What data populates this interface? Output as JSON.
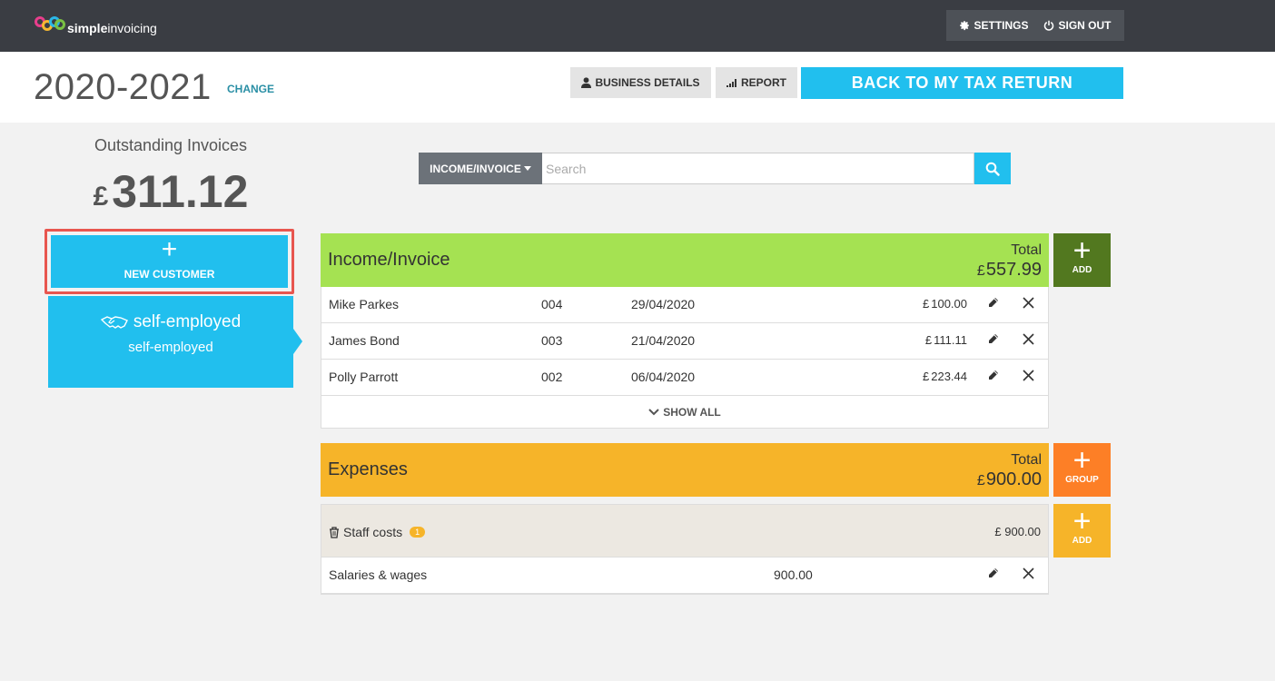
{
  "app": {
    "logo_text_bold": "simple",
    "logo_text": "invoicing"
  },
  "topbar": {
    "settings_label": "SETTINGS",
    "signout_label": "SIGN OUT"
  },
  "header": {
    "year": "2020-2021",
    "change_label": "CHANGE",
    "business_details_label": "BUSINESS DETAILS",
    "report_label": "REPORT",
    "back_label": "BACK TO MY TAX RETURN"
  },
  "left_panel": {
    "outstanding_label": "Outstanding Invoices",
    "currency": "£",
    "outstanding_amount": "311.12",
    "new_customer_label": "NEW CUSTOMER",
    "customer_name": "self-employed",
    "customer_sub": "self-employed"
  },
  "search": {
    "dropdown_label": "INCOME/INVOICE",
    "placeholder": "Search"
  },
  "income": {
    "title": "Income/Invoice",
    "total_label": "Total",
    "currency": "£",
    "total_value": "557.99",
    "add_label": "ADD",
    "rows": [
      {
        "name": "Mike Parkes",
        "number": "004",
        "date": "29/04/2020",
        "currency": "£",
        "amount": "100.00"
      },
      {
        "name": "James Bond",
        "number": "003",
        "date": "21/04/2020",
        "currency": "£",
        "amount": "111.11"
      },
      {
        "name": "Polly Parrott",
        "number": "002",
        "date": "06/04/2020",
        "currency": "£",
        "amount": "223.44"
      }
    ],
    "show_all_label": "SHOW ALL"
  },
  "expenses": {
    "title": "Expenses",
    "total_label": "Total",
    "currency": "£",
    "total_value": "900.00",
    "group_label": "GROUP",
    "add_label": "ADD",
    "group": {
      "name": "Staff costs",
      "count": "1",
      "amount": "£ 900.00"
    },
    "rows": [
      {
        "name": "Salaries & wages",
        "amount": "900.00"
      }
    ]
  },
  "colors": {
    "accent_blue": "#21bfee",
    "income_green": "#a5e252",
    "income_add_dark_green": "#52781f",
    "expense_orange": "#f6b429",
    "group_orange": "#fd7f26",
    "highlight_red": "#e8564f"
  }
}
